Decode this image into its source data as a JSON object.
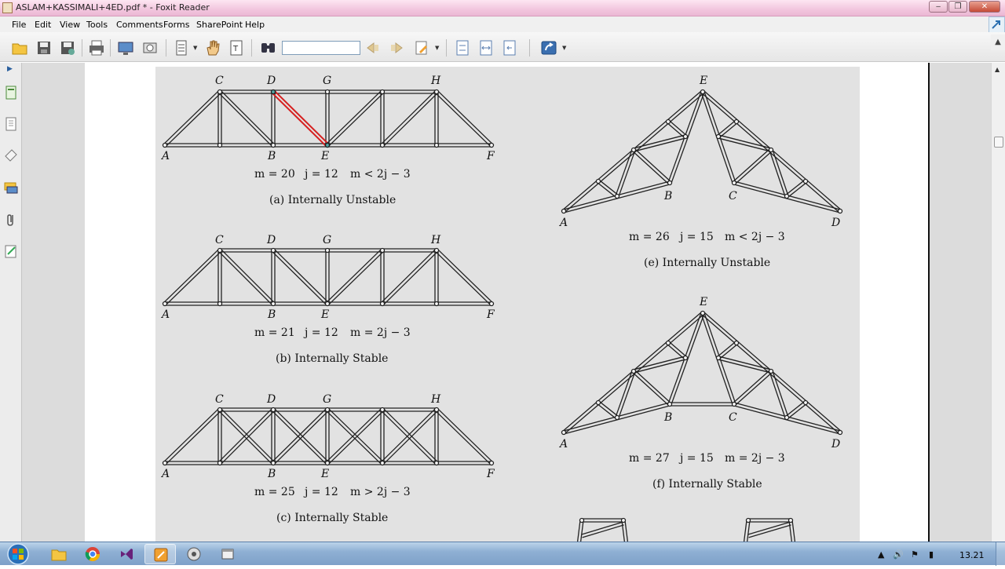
{
  "window": {
    "title": "ASLAM+KASSIMALI+4ED.pdf * - Foxit Reader",
    "minimize": "‒",
    "restore": "❐",
    "close": "✕"
  },
  "menu": [
    "File",
    "Edit",
    "View",
    "Tools",
    "Comments",
    "Forms",
    "SharePoint",
    "Help"
  ],
  "toolbar": {
    "find_value": "",
    "icons": [
      "open-icon",
      "save-icon",
      "save-as-icon",
      "print-icon",
      "full-screen-icon",
      "snapshot-icon",
      "page-layout-icon",
      "hand-tool-icon",
      "select-text-icon",
      "find-icon",
      "previous-icon",
      "next-icon",
      "highlight-icon",
      "fit-page-icon",
      "fit-width-icon",
      "fit-visible-icon",
      "share-icon"
    ]
  },
  "left_panel": [
    "pages-icon",
    "bookmarks-icon",
    "annotations-icon",
    "comments-icon",
    "attachments-icon",
    "signature-icon"
  ],
  "figure": {
    "a": {
      "top": [
        "C",
        "D",
        "G",
        "H"
      ],
      "bottom": [
        "A",
        "B",
        "E",
        "F"
      ],
      "eq": [
        "m = 20",
        "j = 12",
        "m < 2j − 3"
      ],
      "caption": "(a) Internally Unstable"
    },
    "b": {
      "top": [
        "C",
        "D",
        "G",
        "H"
      ],
      "bottom": [
        "A",
        "B",
        "E",
        "F"
      ],
      "eq": [
        "m = 21",
        "j = 12",
        "m = 2j − 3"
      ],
      "caption": "(b) Internally Stable"
    },
    "c": {
      "top": [
        "C",
        "D",
        "G",
        "H"
      ],
      "bottom": [
        "A",
        "B",
        "E",
        "F"
      ],
      "eq": [
        "m = 25",
        "j = 12",
        "m > 2j − 3"
      ],
      "caption": "(c) Internally Stable"
    },
    "e": {
      "labels": [
        "E",
        "A",
        "B",
        "C",
        "D"
      ],
      "eq": [
        "m = 26",
        "j = 15",
        "m < 2j − 3"
      ],
      "caption": "(e) Internally Unstable"
    },
    "f": {
      "labels": [
        "E",
        "A",
        "B",
        "C",
        "D"
      ],
      "eq": [
        "m = 27",
        "j = 15",
        "m = 2j − 3"
      ],
      "caption": "(f) Internally Stable"
    }
  },
  "taskbar": {
    "apps": [
      "start-orb",
      "explorer-icon",
      "chrome-icon",
      "visual-studio-icon",
      "foxit-icon",
      "media-icon",
      "window-icon"
    ],
    "clock": "13.21"
  }
}
